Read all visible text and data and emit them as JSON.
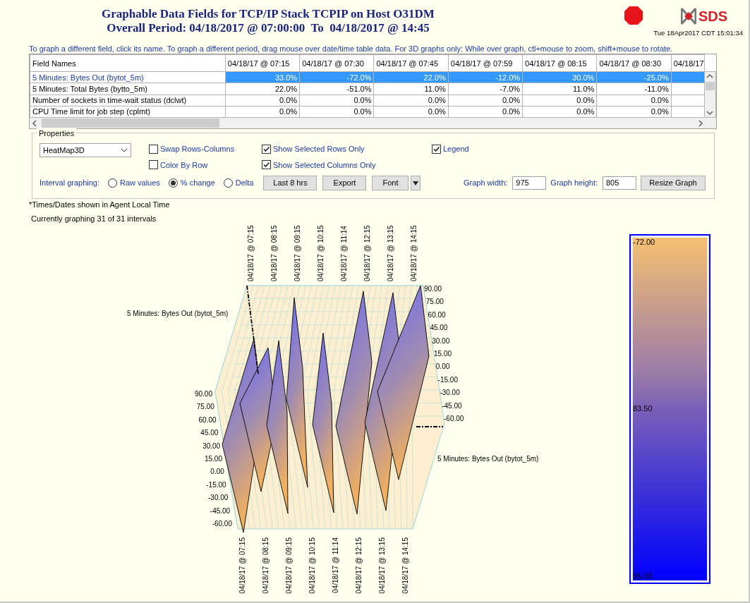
{
  "header": {
    "title_lines": [
      "Graphable Data Fields for TCP/IP Stack TCPIP on Host O31DM",
      "Overall Period: 04/18/2017 @ 07:00:00  To  04/18/2017 @ 14:45"
    ],
    "logo_text": "SDS",
    "timestamp": "Tue 18Apr2017 CDT 15:01:34"
  },
  "instructions": "To graph a different field, click its name.  To graph a different period, drag mouse over date/time table data.  For 3D graphs only: While over graph, ctl+mouse to zoom, shift+mouse to rotate.",
  "table": {
    "columns": [
      "Field Names",
      "04/18/17 @ 07:15",
      "04/18/17 @ 07:30",
      "04/18/17 @ 07:45",
      "04/18/17 @ 07:59",
      "04/18/17 @ 08:15",
      "04/18/17 @ 08:30",
      "04/18/17"
    ],
    "rows": [
      {
        "name": "5 Minutes: Bytes Out (bytot_5m)",
        "selected": true,
        "values": [
          "33.0%",
          "-72.0%",
          "22.0%",
          "-12.0%",
          "30.0%",
          "-25.0%"
        ]
      },
      {
        "name": "5 Minutes: Total Bytes (bytto_5m)",
        "selected": false,
        "values": [
          "22.0%",
          "-51.0%",
          "11.0%",
          "-7.0%",
          "11.0%",
          "-11.0%"
        ]
      },
      {
        "name": "Number of sockets in time-wait status (dclwt)",
        "selected": false,
        "values": [
          "0.0%",
          "0.0%",
          "0.0%",
          "0.0%",
          "0.0%",
          "0.0%"
        ]
      },
      {
        "name": "CPU Time limit for job step (cplmt)",
        "selected": false,
        "values": [
          "0.0%",
          "0.0%",
          "0.0%",
          "0.0%",
          "0.0%",
          "0.0%"
        ]
      }
    ]
  },
  "properties": {
    "legend": "Properties",
    "chart_type": "HeatMap3D",
    "checkbox_columns": [
      [
        {
          "label": "Swap Rows-Columns",
          "checked": false
        },
        {
          "label": "Color By Row",
          "checked": false
        }
      ],
      [
        {
          "label": "Show Selected Rows Only",
          "checked": true
        },
        {
          "label": "Show Selected Columns Only",
          "checked": true
        }
      ],
      [
        {
          "label": "Legend",
          "checked": true
        }
      ]
    ],
    "interval_label": "Interval graphing:",
    "radios": [
      {
        "label": "Raw values",
        "selected": false
      },
      {
        "label": "% change",
        "selected": true
      },
      {
        "label": "Delta",
        "selected": false
      }
    ],
    "buttons": [
      "Last 8 hrs",
      "Export",
      "Font"
    ],
    "width_label": "Graph width:",
    "width_value": "975",
    "height_label": "Graph height:",
    "height_value": "805",
    "resize_button": "Resize Graph"
  },
  "notes": [
    "*Times/Dates shown in Agent Local Time",
    "Currently graphing 31 of 31 intervals"
  ],
  "graph": {
    "series_labels": [
      "5 Minutes: Bytes Out (bytot_5m)",
      "5 Minutes: Bytes Out (bytot_5m)"
    ],
    "top_x_labels": [
      "04/18/17 @ 07:15",
      "04/18/17 @ 08:15",
      "04/18/17 @ 09:15",
      "04/18/17 @ 10:15",
      "04/18/17 @ 11:14",
      "04/18/17 @ 12:15",
      "04/18/17 @ 13:15",
      "04/18/17 @ 14:15"
    ],
    "bottom_x_labels": [
      "04/18/17 @ 07:15",
      "04/18/17 @ 08:15",
      "04/18/17 @ 09:15",
      "04/18/17 @ 10:15",
      "04/18/17 @ 11:14",
      "04/18/17 @ 12:15",
      "04/18/17 @ 13:15",
      "04/18/17 @ 14:15"
    ],
    "right_y_ticks": [
      "90.00",
      "75.00",
      "60.00",
      "45.00",
      "30.00",
      "15.00",
      "0.00",
      "-15.00",
      "-30.00",
      "-45.00",
      "-60.00"
    ],
    "left_y_ticks": [
      "90.00",
      "75.00",
      "60.00",
      "45.00",
      "30.00",
      "15.00",
      "0.00",
      "-15.00",
      "-30.00",
      "-45.00",
      "-60.00"
    ]
  },
  "legend": {
    "labels": [
      "-72.00",
      "83.50",
      "95.00"
    ]
  }
}
